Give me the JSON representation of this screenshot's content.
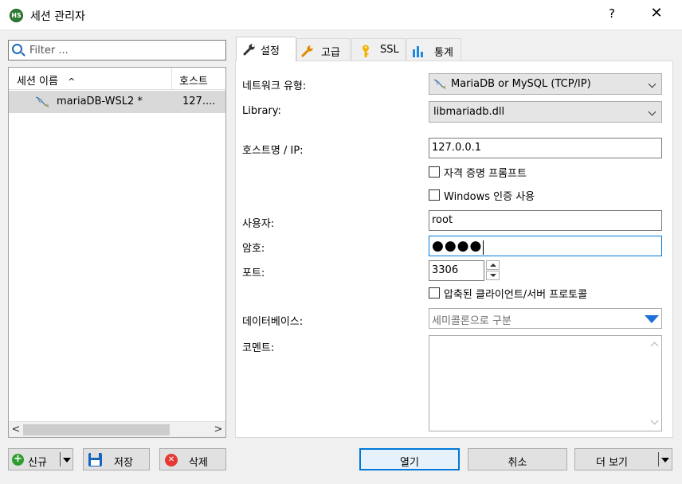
{
  "window": {
    "title": "세션 관리자",
    "app_icon_text": "HS",
    "help": "?",
    "close": "✕"
  },
  "filter": {
    "placeholder": "Filter ..."
  },
  "session_list": {
    "col_name": "세션 이름",
    "col_host": "호스트",
    "sort_arrow": "^",
    "rows": [
      {
        "name": "mariaDB-WSL2 *",
        "host": "127...."
      }
    ],
    "scroll_left": "<",
    "scroll_right": ">"
  },
  "left_buttons": {
    "new": "신규",
    "save": "저장",
    "delete": "삭제"
  },
  "tabs": [
    {
      "label": "설정",
      "icon": "wrench-icon",
      "active": true
    },
    {
      "label": "고급",
      "icon": "wrench-icon"
    },
    {
      "label": "SSL",
      "icon": "key-icon"
    },
    {
      "label": "통계",
      "icon": "bar-chart-icon"
    }
  ],
  "settings": {
    "network_type_label": "네트워크 유형:",
    "network_type_value": "MariaDB or MySQL (TCP/IP)",
    "library_label": "Library:",
    "library_value": "libmariadb.dll",
    "host_label": "호스트명 / IP:",
    "host_value": "127.0.0.1",
    "prompt_credentials": "자격 증명 프롬프트",
    "windows_auth": "Windows 인증 사용",
    "user_label": "사용자:",
    "user_value": "root",
    "password_label": "암호:",
    "password_value": "●●●●",
    "port_label": "포트:",
    "port_value": "3306",
    "compressed_protocol": "압축된 클라이언트/서버 프로토콜",
    "database_label": "데이터베이스:",
    "database_placeholder": "세미콜론으로 구분",
    "comment_label": "코멘트:"
  },
  "bottom_buttons": {
    "open": "열기",
    "cancel": "취소",
    "more": "더 보기"
  },
  "colors": {
    "accent": "#0078d7",
    "dropdown_arrow": "#1e6fd9"
  }
}
